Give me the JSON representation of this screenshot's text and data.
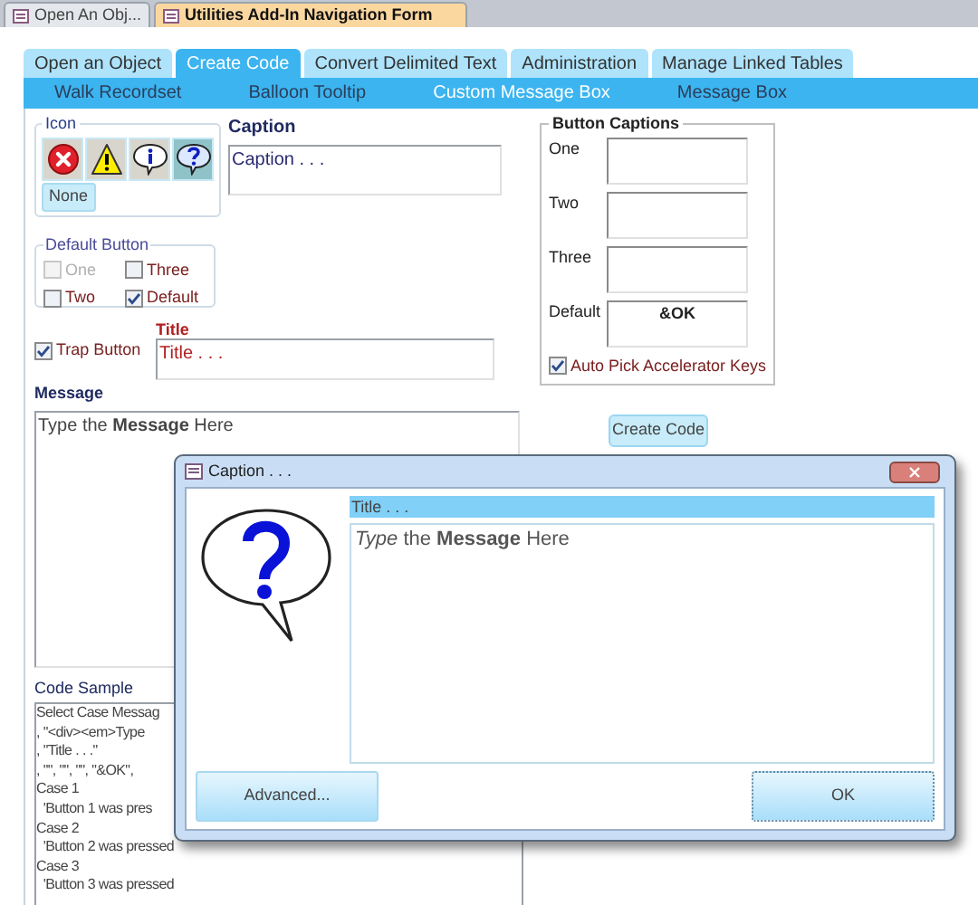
{
  "document_tabs": [
    {
      "label": "Open An Obj...",
      "selected": false
    },
    {
      "label": "Utilities Add-In Navigation Form",
      "selected": true
    }
  ],
  "main_tabs": [
    {
      "label": "Open an Object",
      "selected": false
    },
    {
      "label": "Create Code",
      "selected": true
    },
    {
      "label": "Convert Delimited Text",
      "selected": false
    },
    {
      "label": "Administration",
      "selected": false
    },
    {
      "label": "Manage Linked Tables",
      "selected": false
    }
  ],
  "sub_tabs": [
    {
      "label": "Walk Recordset",
      "selected": false
    },
    {
      "label": "Balloon Tooltip",
      "selected": false
    },
    {
      "label": "Custom Message Box",
      "selected": true
    },
    {
      "label": "Message Box",
      "selected": false
    }
  ],
  "icon_group": {
    "legend": "Icon",
    "icons": [
      {
        "kind": "error",
        "selected": false
      },
      {
        "kind": "warning",
        "selected": false
      },
      {
        "kind": "info",
        "selected": false
      },
      {
        "kind": "question",
        "selected": true
      }
    ],
    "none_button": "None"
  },
  "caption": {
    "label": "Caption",
    "value": "Caption . . ."
  },
  "default_button": {
    "legend": "Default Button",
    "options": [
      {
        "label": "One",
        "checked": false,
        "disabled": true
      },
      {
        "label": "Three",
        "checked": false,
        "disabled": false
      },
      {
        "label": "Two",
        "checked": false,
        "disabled": false
      },
      {
        "label": "Default",
        "checked": true,
        "disabled": false
      }
    ]
  },
  "trap_button": {
    "label": "Trap Button",
    "checked": true
  },
  "title": {
    "label": "Title",
    "value": "Title . . ."
  },
  "message": {
    "label": "Message",
    "value": "Type the **Message** Here"
  },
  "button_captions": {
    "legend": "Button Captions",
    "fields": [
      {
        "label": "One"
      },
      {
        "label": "Two"
      },
      {
        "label": "Three"
      },
      {
        "label": "Default",
        "value": "&OK"
      }
    ],
    "auto_pick": {
      "label": "Auto Pick Accelerator Keys",
      "checked": true
    }
  },
  "create_code_button": "Create Code",
  "code_sample": {
    "label": "Code Sample",
    "lines": [
      "Select Case Messag",
      ", \"<div><em>Type",
      ", \"Title . . .\"",
      ", \"\", \"\", \"\", \"&OK\",",
      "Case 1",
      "  'Button 1 was pres",
      "Case 2",
      "  'Button 2 was pressed",
      "Case 3",
      "  'Button 3 was pressed"
    ]
  },
  "dialog": {
    "title": "Caption . . .",
    "heading": "Title . . .",
    "message": "*Type* the **Message** Here",
    "buttons": [
      "Advanced...",
      "OK"
    ]
  }
}
